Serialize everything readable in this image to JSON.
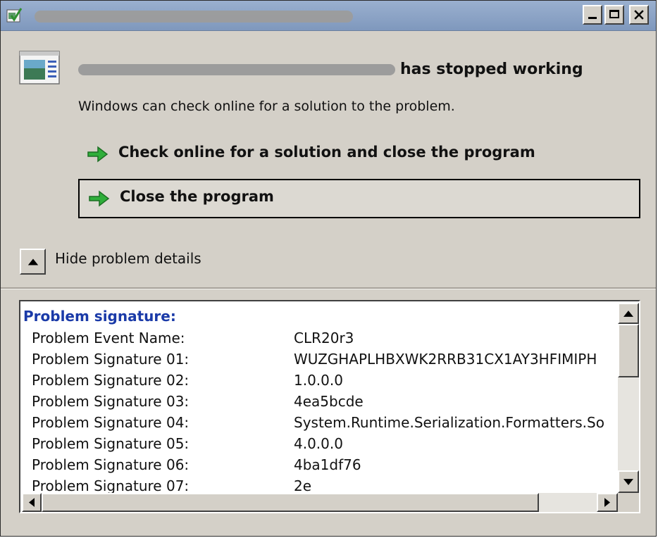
{
  "window": {
    "title": "",
    "buttons": {
      "minimize": "minimize",
      "maximize": "maximize",
      "close": "close"
    }
  },
  "header": {
    "app_name_redacted": "",
    "heading_suffix": "has stopped working",
    "description": "Windows can check online for a solution to the problem."
  },
  "commands": [
    {
      "label": "Check online for a solution and close the program",
      "icon": "green-arrow-icon"
    },
    {
      "label": "Close the program",
      "icon": "green-arrow-icon"
    }
  ],
  "details_toggle": {
    "label": "Hide problem details",
    "icon": "chevron-up-icon"
  },
  "details": {
    "heading": "Problem signature:",
    "rows": [
      {
        "key": "Problem Event Name:",
        "value": "CLR20r3"
      },
      {
        "key": "Problem Signature 01:",
        "value": "WUZGHAPLHBXWK2RRB31CX1AY3HFIMIPH"
      },
      {
        "key": "Problem Signature 02:",
        "value": "1.0.0.0"
      },
      {
        "key": "Problem Signature 03:",
        "value": "4ea5bcde"
      },
      {
        "key": "Problem Signature 04:",
        "value": "System.Runtime.Serialization.Formatters.So"
      },
      {
        "key": "Problem Signature 05:",
        "value": "4.0.0.0"
      },
      {
        "key": "Problem Signature 06:",
        "value": "4ba1df76"
      },
      {
        "key": "Problem Signature 07:",
        "value": "2e"
      }
    ]
  },
  "colors": {
    "titlebar": "#8aa2c6",
    "dialog_bg": "#d4d0c8",
    "heading_blue": "#1a3aa8",
    "arrow_green": "#2fae3a"
  }
}
